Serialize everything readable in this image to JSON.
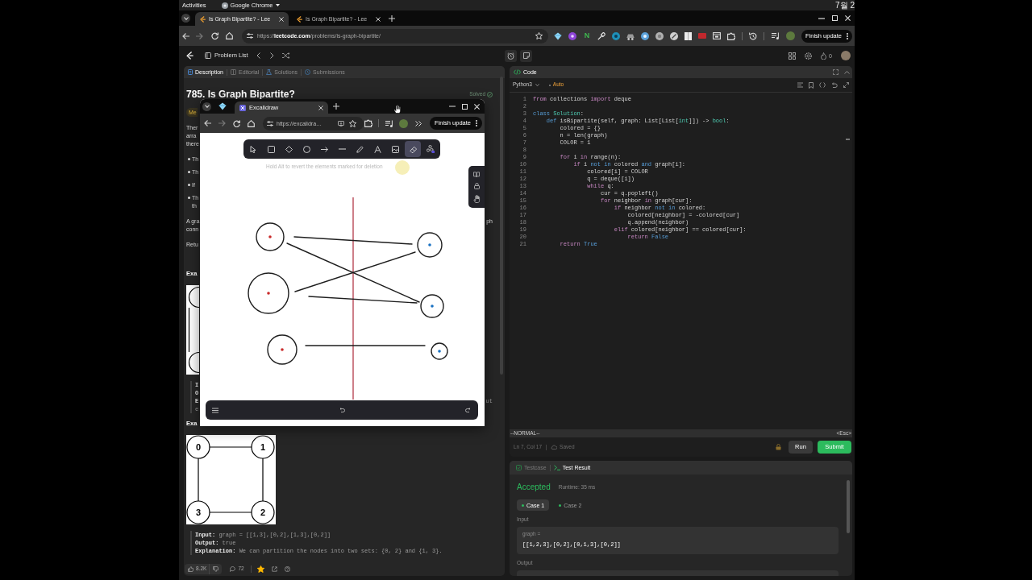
{
  "top_bar": {
    "activities": "Activities",
    "app_menu": "Google Chrome",
    "clock": "7월 2"
  },
  "browser": {
    "tabs": [
      {
        "title": "Is Graph Bipartite? - Lee",
        "selected": true
      },
      {
        "title": "Is Graph Bipartite? - Lee",
        "selected": false
      }
    ],
    "address": "https://**leetcode.com**/problems/is-graph-bipartite/",
    "extension_letter": "N",
    "update_button": "Finish update"
  },
  "site_header": {
    "problem_list": "Problem List",
    "streak_count": "0"
  },
  "problem_panel": {
    "tabs": [
      {
        "kind": "description",
        "label": "Description",
        "selected": true
      },
      {
        "kind": "editorial",
        "label": "Editorial",
        "selected": false
      },
      {
        "kind": "solutions",
        "label": "Solutions",
        "selected": false
      },
      {
        "kind": "submissions",
        "label": "Submissions",
        "selected": false
      }
    ],
    "title": "785. Is Graph Bipartite?",
    "status": "Solved",
    "difficulty": "Me",
    "description": [
      {
        "kind": "paragraph",
        "lines": [
          {
            "start": "Ther"
          },
          {
            "start": "arra"
          },
          {
            "start": "there"
          }
        ]
      },
      {
        "kind": "bullets",
        "items": [
          {
            "lines": [
              {
                "start": "Th"
              }
            ]
          },
          {
            "lines": [
              {
                "start": "Th"
              }
            ]
          },
          {
            "lines": [
              {
                "start": "If"
              }
            ]
          },
          {
            "lines": [
              {
                "start": "Th"
              },
              {
                "start": "th"
              }
            ]
          }
        ]
      },
      {
        "kind": "paragraph",
        "lines": [
          {
            "start": "A gra",
            "end": "ph"
          },
          {
            "start": "conn"
          }
        ]
      },
      {
        "kind": "paragraph",
        "lines": [
          {
            "start": "Retu"
          }
        ]
      },
      {
        "kind": "heading",
        "text": "Exa"
      },
      {
        "kind": "figure_strip"
      },
      {
        "kind": "example",
        "lines": [
          {
            "label": "I"
          },
          {
            "label": "O"
          },
          {
            "label": "E",
            "end": "ut"
          },
          {
            "value": "e"
          }
        ]
      },
      {
        "kind": "heading",
        "text": "Exa"
      },
      {
        "kind": "figure",
        "nodes": [
          {
            "label": "0"
          },
          {
            "label": "1"
          },
          {
            "label": "3"
          },
          {
            "label": "2"
          }
        ]
      },
      {
        "kind": "example",
        "lines": [
          {
            "label": "Input:",
            "value": "graph = [[1,3],[0,2],[1,3],[0,2]]"
          },
          {
            "label": "Output:",
            "value": "true"
          },
          {
            "label": "Explanation:",
            "value": "We can partition the nodes into two sets: {0, 2} and {1, 3}."
          }
        ]
      }
    ],
    "stats": {
      "likes": "8.2K",
      "comments": "72",
      "favorited": true
    }
  },
  "code_panel": {
    "title": "Code",
    "language": "Python3",
    "mode": "Auto",
    "lines": [
      {
        "number": "1",
        "tokens": [
          {
            "text": "from",
            "kind": "control"
          },
          {
            "text": " collections ",
            "kind": "plain"
          },
          {
            "text": "import",
            "kind": "control"
          },
          {
            "text": " deque",
            "kind": "plain"
          }
        ]
      },
      {
        "number": "2"
      },
      {
        "number": "3",
        "tokens": [
          {
            "text": "class ",
            "kind": "keyword"
          },
          {
            "text": "Solution",
            "kind": "type"
          },
          {
            "text": ":",
            "kind": "plain"
          }
        ]
      },
      {
        "number": "4",
        "tokens": [
          {
            "text": "    def",
            "kind": "keyword"
          },
          {
            "text": " isBipartite(self, graph: List[List[",
            "kind": "plain"
          },
          {
            "text": "int",
            "kind": "type"
          },
          {
            "text": "]]) -> ",
            "kind": "plain"
          },
          {
            "text": "bool",
            "kind": "type"
          },
          {
            "text": ":",
            "kind": "plain"
          }
        ]
      },
      {
        "number": "5",
        "tokens": [
          {
            "text": "        colored = {}",
            "kind": "plain"
          }
        ]
      },
      {
        "number": "6",
        "tokens": [
          {
            "text": "        n = len(graph)",
            "kind": "plain"
          }
        ]
      },
      {
        "number": "7",
        "tokens": [
          {
            "text": "        COLOR = 1",
            "kind": "plain"
          }
        ]
      },
      {
        "number": "8"
      },
      {
        "number": "9",
        "tokens": [
          {
            "text": "        for",
            "kind": "control"
          },
          {
            "text": " i ",
            "kind": "plain"
          },
          {
            "text": "in",
            "kind": "control"
          },
          {
            "text": " range(n):",
            "kind": "plain"
          }
        ]
      },
      {
        "number": "10",
        "tokens": [
          {
            "text": "            if",
            "kind": "control"
          },
          {
            "text": " i ",
            "kind": "plain"
          },
          {
            "text": "not in",
            "kind": "keyword"
          },
          {
            "text": " colored ",
            "kind": "plain"
          },
          {
            "text": "and",
            "kind": "keyword"
          },
          {
            "text": " graph[i]:",
            "kind": "plain"
          }
        ]
      },
      {
        "number": "11",
        "tokens": [
          {
            "text": "                colored[i] = COLOR",
            "kind": "plain"
          }
        ]
      },
      {
        "number": "12",
        "tokens": [
          {
            "text": "                q = deque([i])",
            "kind": "plain"
          }
        ]
      },
      {
        "number": "13",
        "tokens": [
          {
            "text": "                while",
            "kind": "control"
          },
          {
            "text": " q:",
            "kind": "plain"
          }
        ]
      },
      {
        "number": "14",
        "tokens": [
          {
            "text": "                    cur = q.popleft()",
            "kind": "plain"
          }
        ]
      },
      {
        "number": "15",
        "tokens": [
          {
            "text": "                    for",
            "kind": "control"
          },
          {
            "text": " neighbor ",
            "kind": "plain"
          },
          {
            "text": "in",
            "kind": "control"
          },
          {
            "text": " graph[cur]:",
            "kind": "plain"
          }
        ]
      },
      {
        "number": "16",
        "tokens": [
          {
            "text": "                        if",
            "kind": "control"
          },
          {
            "text": " neighbor ",
            "kind": "plain"
          },
          {
            "text": "not in",
            "kind": "keyword"
          },
          {
            "text": " colored:",
            "kind": "plain"
          }
        ]
      },
      {
        "number": "17",
        "tokens": [
          {
            "text": "                            colored[neighbor] = -colored[cur]",
            "kind": "plain"
          }
        ]
      },
      {
        "number": "18",
        "tokens": [
          {
            "text": "                            q.append(neighbor)",
            "kind": "plain"
          }
        ]
      },
      {
        "number": "19",
        "tokens": [
          {
            "text": "                        elif",
            "kind": "control"
          },
          {
            "text": " colored[neighbor] == colored[cur]:",
            "kind": "plain"
          }
        ]
      },
      {
        "number": "20",
        "tokens": [
          {
            "text": "                            return ",
            "kind": "control"
          },
          {
            "text": "False",
            "kind": "keyword"
          }
        ]
      },
      {
        "number": "21",
        "tokens": [
          {
            "text": "        return ",
            "kind": "control"
          },
          {
            "text": "True",
            "kind": "keyword"
          }
        ]
      }
    ],
    "vim_mode": "--NORMAL--",
    "vim_hint": "<Esc>",
    "cursor": "Ln 7, Col 17",
    "save_state": "Saved",
    "buttons": {
      "run": "Run",
      "submit": "Submit"
    }
  },
  "test_panel": {
    "tabs": [
      {
        "kind": "testcase",
        "label": "Testcase",
        "selected": false
      },
      {
        "kind": "result",
        "label": "Test Result",
        "selected": true
      }
    ],
    "verdict": "Accepted",
    "runtime": "Runtime: 35 ms",
    "cases": [
      {
        "label": "Case 1",
        "selected": true
      },
      {
        "label": "Case 2",
        "selected": false
      }
    ],
    "input_label": "Input",
    "parameter": "graph =",
    "input_value": "[[1,2,3],[0,2],[0,1,3],[0,2]]",
    "output_label": "Output"
  },
  "popup": {
    "tab": "Excalidraw",
    "address": "https://excalidra…",
    "update_button": "Finish update",
    "toolbar": [
      {
        "kind": "select",
        "selected": false
      },
      {
        "kind": "rectangle",
        "selected": false
      },
      {
        "kind": "diamond",
        "selected": false
      },
      {
        "kind": "ellipse",
        "selected": false
      },
      {
        "kind": "arrow",
        "selected": false
      },
      {
        "kind": "line",
        "selected": false
      },
      {
        "kind": "draw",
        "selected": false
      },
      {
        "kind": "text",
        "selected": false
      },
      {
        "kind": "image",
        "selected": false
      },
      {
        "kind": "eraser",
        "selected": true
      },
      {
        "kind": "shapes",
        "selected": false
      }
    ],
    "hint": "Hold Alt to revert the elements marked for deletion",
    "canvas": {
      "nodes": [
        {
          "color": "#c92a2a"
        },
        {
          "color": "#c92a2a"
        },
        {
          "color": "#c92a2a"
        },
        {
          "color": "#1971c2"
        },
        {
          "color": "#1971c2"
        },
        {
          "color": "#1971c2"
        }
      ]
    }
  }
}
